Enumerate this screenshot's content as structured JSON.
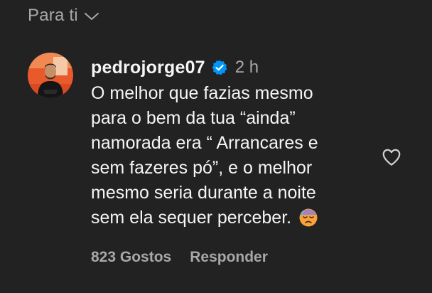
{
  "filter": {
    "label": "Para ti",
    "icon": "chevron-down-icon"
  },
  "comment": {
    "username": "pedrojorge07",
    "verified": true,
    "time": "2 h",
    "text_lines": [
      "O melhor que fazias mesmo",
      "para o bem da tua “ainda”",
      "namorada era “ Arrancares e",
      "sem fazeres pó”, e o melhor",
      "mesmo seria durante a noite",
      "sem ela sequer perceber."
    ],
    "emoji": "sleepy-face-with-sweat-emoji",
    "likes_label": "823 Gostos",
    "reply_label": "Responder",
    "like_icon": "heart-outline-icon"
  },
  "colors": {
    "background": "#222222",
    "primary_text": "#f5f5f5",
    "secondary_text": "#a8a8a8",
    "verified_badge": "#0095f6"
  }
}
